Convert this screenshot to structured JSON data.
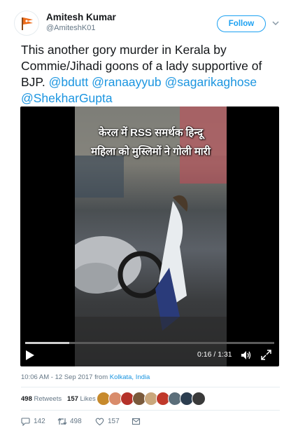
{
  "user": {
    "name": "Amitesh Kumar",
    "handle": "@AmiteshK01",
    "follow_label": "Follow"
  },
  "tweet": {
    "text_plain": "This another gory murder in Kerala by Commie/Jihadi goons of a lady supportive of BJP.",
    "mentions": [
      "@bdutt",
      "@ranaayyub",
      "@sagarikaghose",
      "@ShekharGupta"
    ]
  },
  "video": {
    "caption_line1": "केरल में RSS समर्थक हिन्दू",
    "caption_line2": "महिला को मुस्लिमों ने गोली मारी",
    "time_display": "0:16 / 1:31",
    "progress_fraction": 0.176
  },
  "meta": {
    "timestamp": "10:06 AM - 12 Sep 2017 from",
    "location": "Kolkata, India"
  },
  "stats": {
    "retweets_count": "498",
    "retweets_label": "Retweets",
    "likes_count": "157",
    "likes_label": "Likes",
    "liker_colors": [
      "#c78a2c",
      "#d98c6b",
      "#b5322a",
      "#7a5a3c",
      "#caa77c",
      "#c0392b",
      "#5b6e7a",
      "#2c3e50",
      "#3a3a3a"
    ]
  },
  "actions": {
    "reply_count": "142",
    "retweet_count": "498",
    "like_count": "157"
  },
  "colors": {
    "accent": "#1da1f2",
    "link": "#1b95e0",
    "secondary_text": "#657786"
  }
}
